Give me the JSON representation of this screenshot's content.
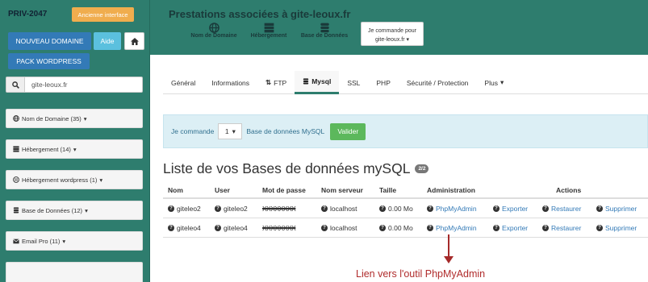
{
  "sidebar": {
    "brand": "PRIV-2047",
    "old_interface_label": "Ancienne interface",
    "new_domain_label": "NOUVEAU DOMAINE",
    "help_label": "Aide",
    "wordpress_pack_label": "PACK WORDPRESS",
    "search": {
      "value": "gite-leoux.fr"
    },
    "items": [
      {
        "label": "Nom de Domaine (35)",
        "icon": "globe-icon"
      },
      {
        "label": "Hébergement (14)",
        "icon": "server-icon"
      },
      {
        "label": "Hébergement wordpress (1)",
        "icon": "wordpress-icon"
      },
      {
        "label": "Base de Données (12)",
        "icon": "database-icon"
      },
      {
        "label": "Email Pro (11)",
        "icon": "envelope-icon"
      }
    ]
  },
  "header": {
    "title": "Prestations associées à gite-leoux.fr",
    "icons": [
      {
        "label": "Nom de Domaine",
        "icon": "globe-icon"
      },
      {
        "label": "Hébergement",
        "icon": "server-icon"
      },
      {
        "label": "Base de Données",
        "icon": "database-icon"
      }
    ],
    "command_for_line1": "Je commande pour",
    "command_for_line2": "gite-leoux.fr"
  },
  "tabs": [
    {
      "label": "Général",
      "icon": ""
    },
    {
      "label": "Informations",
      "icon": ""
    },
    {
      "label": "FTP",
      "icon": "transfer-icon"
    },
    {
      "label": "Mysql",
      "icon": "database-icon",
      "active": true
    },
    {
      "label": "SSL",
      "icon": ""
    },
    {
      "label": "PHP",
      "icon": ""
    },
    {
      "label": "Sécurité / Protection",
      "icon": ""
    },
    {
      "label": "Plus",
      "icon": "caret-icon"
    }
  ],
  "order_bar": {
    "prefix": "Je commande",
    "quantity": "1",
    "suffix": "Base de données MySQL",
    "submit_label": "Valider"
  },
  "list": {
    "title": "Liste de vos Bases de données mySQL",
    "count_badge": "2/2",
    "columns": [
      "Nom",
      "User",
      "Mot de passe",
      "Nom serveur",
      "Taille",
      "Administration",
      "Actions"
    ],
    "rows": [
      {
        "name": "giteleo2",
        "user": "giteleo2",
        "password": "XXXXXXXX",
        "server": "localhost",
        "size": "0.00 Mo",
        "admin": "PhpMyAdmin",
        "export": "Exporter",
        "restore": "Restaurer",
        "delete": "Supprimer"
      },
      {
        "name": "giteleo4",
        "user": "giteleo4",
        "password": "XXXXXXXX",
        "server": "localhost",
        "size": "0.00 Mo",
        "admin": "PhpMyAdmin",
        "export": "Exporter",
        "restore": "Restaurer",
        "delete": "Supprimer"
      }
    ]
  },
  "annotation": {
    "text": "Lien vers l'outil PhpMyAdmin",
    "color": "#b02c2c"
  },
  "colors": {
    "brand_green": "#2e7d6e",
    "primary": "#337ab7",
    "info": "#5bc0de",
    "warning": "#f0ad4e",
    "success": "#5cb85c"
  }
}
